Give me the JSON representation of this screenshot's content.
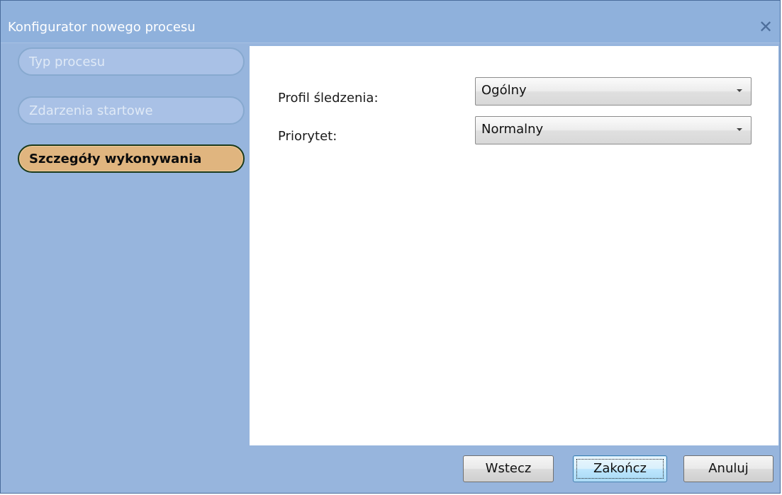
{
  "window": {
    "title": "Konfigurator nowego procesu",
    "close_glyph": "✕"
  },
  "sidebar": {
    "steps": [
      {
        "label": "Typ procesu",
        "state": "inactive"
      },
      {
        "label": "Zdarzenia startowe",
        "state": "inactive"
      },
      {
        "label": "Szczegóły wykonywania",
        "state": "active"
      }
    ]
  },
  "form": {
    "tracking_profile": {
      "label": "Profil śledzenia:",
      "value": "Ogólny"
    },
    "priority": {
      "label": "Priorytet:",
      "value": "Normalny"
    }
  },
  "buttons": {
    "back": "Wstecz",
    "finish": "Zakończ",
    "cancel": "Anuluj"
  },
  "colors": {
    "frame": "#97b5dd",
    "active_step": "#e0b57f",
    "inactive_step": "#a9c1e6"
  }
}
